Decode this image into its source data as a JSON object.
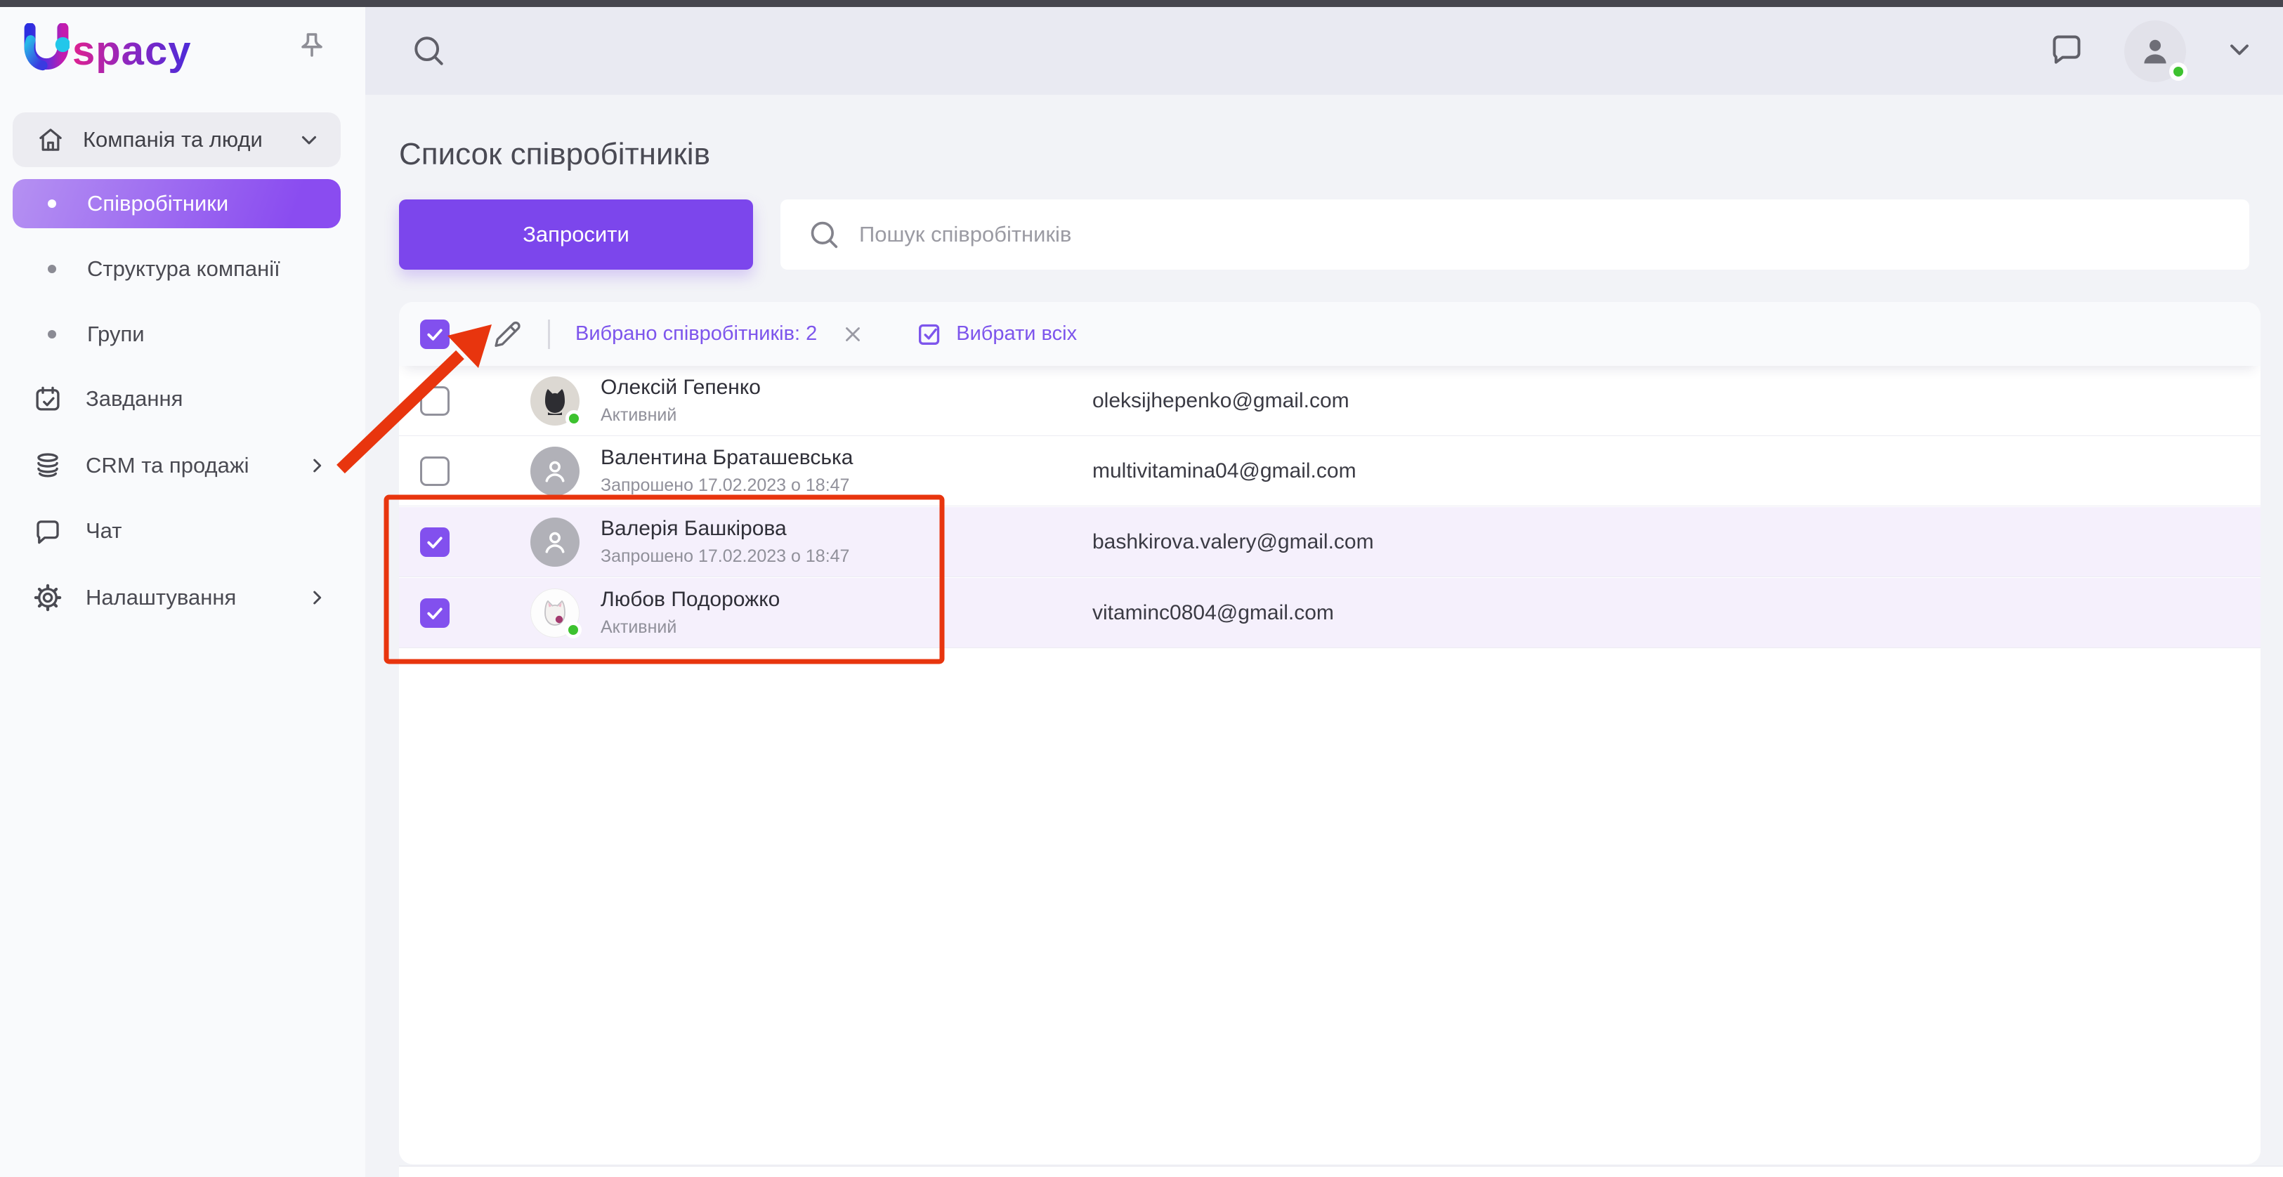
{
  "brand": {
    "logo_text": "spacy"
  },
  "topbar": {},
  "sidebar": {
    "section": {
      "label": "Компанія та люди"
    },
    "items": [
      {
        "label": "Співробітники",
        "active": true
      },
      {
        "label": "Структура компанії"
      },
      {
        "label": "Групи"
      },
      {
        "label": "Завдання"
      },
      {
        "label": "CRM та продажі"
      },
      {
        "label": "Чат"
      },
      {
        "label": "Налаштування"
      }
    ]
  },
  "header": {
    "title": "Список співробітників"
  },
  "actions": {
    "invite_label": "Запросити",
    "search_placeholder": "Пошук співробітників"
  },
  "toolbar": {
    "selected_label": "Вибрано співробітників: 2",
    "select_all_label": "Вибрати всіх"
  },
  "table": {
    "rows": [
      {
        "name": "Олексій Гепенко",
        "status": "Активний",
        "email": "oleksijhepenko@gmail.com",
        "checked": false,
        "online": true,
        "avatar": "black-cat-photo"
      },
      {
        "name": "Валентина Браташевська",
        "status": "Запрошено 17.02.2023 о 18:47",
        "email": "multivitamina04@gmail.com",
        "checked": false,
        "online": false,
        "avatar": "placeholder"
      },
      {
        "name": "Валерія Башкірова",
        "status": "Запрошено 17.02.2023 о 18:47",
        "email": "bashkirova.valery@gmail.com",
        "checked": true,
        "online": false,
        "avatar": "placeholder"
      },
      {
        "name": "Любов Подорожко",
        "status": "Активний",
        "email": "vitaminc0804@gmail.com",
        "checked": true,
        "online": true,
        "avatar": "white-cat-photo"
      }
    ]
  },
  "colors": {
    "accent": "#7c46ec",
    "checkbox": "#8250ee",
    "selected_row_bg": "#f5f0fc",
    "online_green": "#3dc22f",
    "annotation_red": "#e8350e",
    "topbar_bg": "#e9eaf2",
    "sidebar_bg": "#f9fafc"
  }
}
